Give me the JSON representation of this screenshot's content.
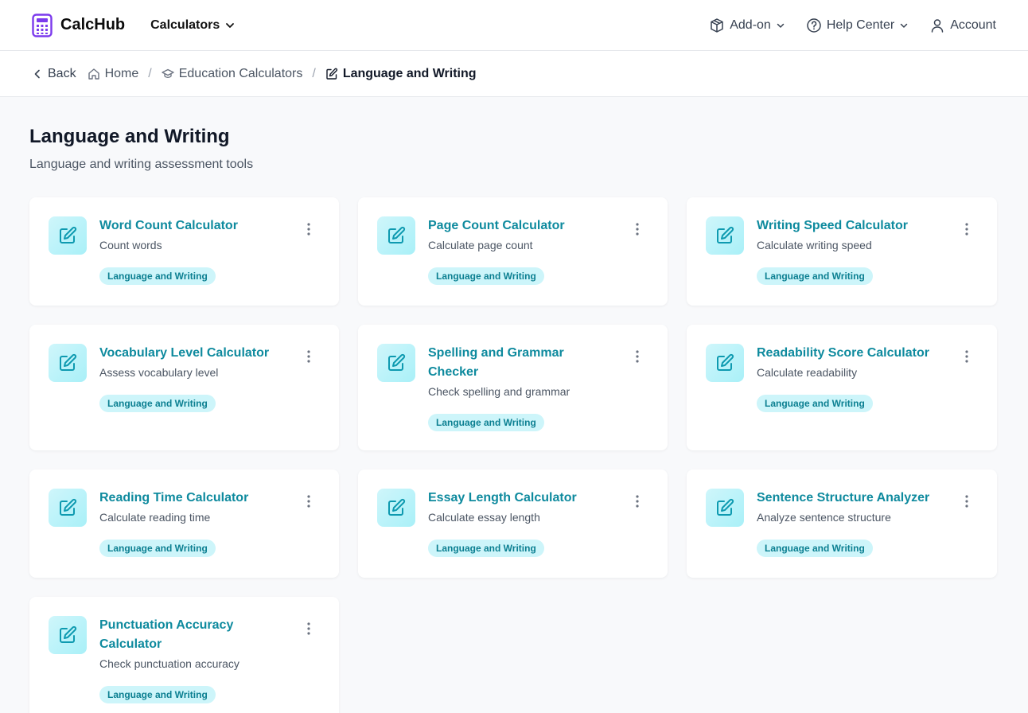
{
  "header": {
    "app_name": "CalcHub",
    "calculators_label": "Calculators",
    "addon_label": "Add-on",
    "help_label": "Help Center",
    "account_label": "Account"
  },
  "breadcrumb": {
    "back": "Back",
    "home": "Home",
    "education": "Education Calculators",
    "current": "Language and Writing"
  },
  "page": {
    "title": "Language and Writing",
    "subtitle": "Language and writing assessment tools"
  },
  "cards": [
    {
      "title": "Word Count Calculator",
      "desc": "Count words",
      "tag": "Language and Writing"
    },
    {
      "title": "Page Count Calculator",
      "desc": "Calculate page count",
      "tag": "Language and Writing"
    },
    {
      "title": "Writing Speed Calculator",
      "desc": "Calculate writing speed",
      "tag": "Language and Writing"
    },
    {
      "title": "Vocabulary Level Calculator",
      "desc": "Assess vocabulary level",
      "tag": "Language and Writing"
    },
    {
      "title": "Spelling and Grammar Checker",
      "desc": "Check spelling and grammar",
      "tag": "Language and Writing"
    },
    {
      "title": "Readability Score Calculator",
      "desc": "Calculate readability",
      "tag": "Language and Writing"
    },
    {
      "title": "Reading Time Calculator",
      "desc": "Calculate reading time",
      "tag": "Language and Writing"
    },
    {
      "title": "Essay Length Calculator",
      "desc": "Calculate essay length",
      "tag": "Language and Writing"
    },
    {
      "title": "Sentence Structure Analyzer",
      "desc": "Analyze sentence structure",
      "tag": "Language and Writing"
    },
    {
      "title": "Punctuation Accuracy Calculator",
      "desc": "Check punctuation accuracy",
      "tag": "Language and Writing"
    }
  ],
  "colors": {
    "brand": "#7c3aed",
    "accent": "#0e8a9e",
    "tag_bg": "#cdf5fa"
  },
  "icons": {
    "logo": "calculator-icon",
    "card": "edit-icon",
    "menu": "more-vertical-icon"
  }
}
